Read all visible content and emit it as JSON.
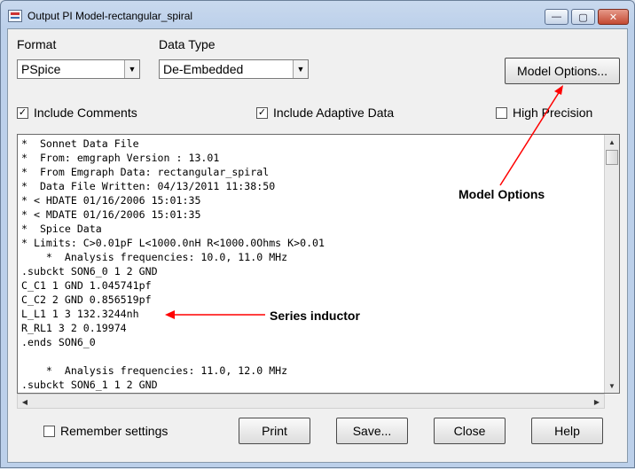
{
  "window": {
    "title": "Output PI Model-rectangular_spiral",
    "controls": {
      "minimize": "—",
      "maximize": "▢",
      "close": "✕"
    }
  },
  "format": {
    "label": "Format",
    "value": "PSpice"
  },
  "data_type": {
    "label": "Data Type",
    "value": "De-Embedded"
  },
  "model_options_button": "Model Options...",
  "checkboxes": {
    "include_comments": {
      "label": "Include Comments",
      "checked": true
    },
    "include_adaptive": {
      "label": "Include Adaptive Data",
      "checked": true
    },
    "high_precision": {
      "label": "High Precision",
      "checked": false
    },
    "remember_settings": {
      "label": "Remember settings",
      "checked": false
    }
  },
  "output_lines": [
    "*  Sonnet Data File",
    "*  From: emgraph Version : 13.01",
    "*  From Emgraph Data: rectangular_spiral",
    "*  Data File Written: 04/13/2011 11:38:50",
    "* < HDATE 01/16/2006 15:01:35",
    "* < MDATE 01/16/2006 15:01:35",
    "*  Spice Data",
    "* Limits: C>0.01pF L<1000.0nH R<1000.0Ohms K>0.01",
    "    *  Analysis frequencies: 10.0, 11.0 MHz",
    ".subckt SON6_0 1 2 GND",
    "C_C1 1 GND 1.045741pf",
    "C_C2 2 GND 0.856519pf",
    "L_L1 1 3 132.3244nh",
    "R_RL1 3 2 0.19974",
    ".ends SON6_0",
    "",
    "    *  Analysis frequencies: 11.0, 12.0 MHz",
    ".subckt SON6_1 1 2 GND"
  ],
  "annotations": {
    "model_options": "Model Options",
    "series_inductor": "Series inductor",
    "color": "#ff0000"
  },
  "buttons": {
    "print": "Print",
    "save": "Save...",
    "close": "Close",
    "help": "Help"
  },
  "icons": {
    "dropdown": "▼",
    "check": "✓",
    "scroll_up": "▲",
    "scroll_down": "▼",
    "scroll_left": "◀",
    "scroll_right": "▶"
  }
}
